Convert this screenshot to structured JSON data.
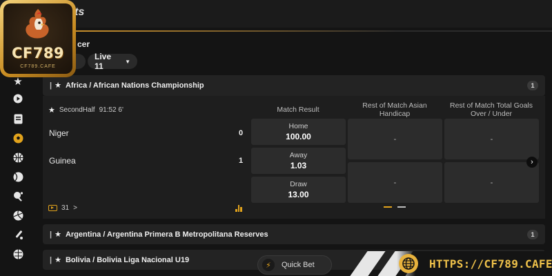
{
  "header": {
    "title_partial": "ts"
  },
  "brand": {
    "logo_text": "CF789",
    "logo_subtext": "CF789.CAFE"
  },
  "section": {
    "title_partial": "cer"
  },
  "filters": {
    "partial_label": ":",
    "live_label": "Live 11"
  },
  "sidebar": {
    "icons": [
      "star-icon",
      "play-icon",
      "betslip-icon",
      "soccer-icon",
      "basketball-icon",
      "tennis-icon",
      "table-tennis-icon",
      "volleyball-icon",
      "cricket-icon",
      "handball-icon"
    ],
    "active": "soccer-icon"
  },
  "leagues": [
    {
      "name": "Africa / African Nations Championship",
      "count": "1"
    },
    {
      "name": "Argentina / Argentina Primera B Metropolitana Reserves",
      "count": "1"
    },
    {
      "name": "Bolivia / Bolivia Liga Nacional U19",
      "count": ""
    }
  ],
  "match": {
    "period": "SecondHalf",
    "clock": "91:52 6'",
    "home_team": "Niger",
    "away_team": "Guinea",
    "home_score": "0",
    "away_score": "1",
    "footer_count": "31",
    "footer_chevron": ">"
  },
  "markets": {
    "match_result": {
      "title": "Match Result",
      "options": [
        {
          "label": "Home",
          "odds": "100.00"
        },
        {
          "label": "Away",
          "odds": "1.03"
        },
        {
          "label": "Draw",
          "odds": "13.00"
        }
      ]
    },
    "asian_handicap": {
      "title": "Rest of Match Asian Handicap",
      "top": "-",
      "bottom": "-"
    },
    "total_goals": {
      "title": "Rest of Match Total Goals Over / Under",
      "top": "-",
      "bottom": "-"
    }
  },
  "quick_bet": {
    "label": "Quick Bet"
  },
  "banner": {
    "url": "HTTPS://CF789.CAFE/"
  },
  "colors": {
    "accent": "#e2a31c",
    "background": "#141414",
    "card": "#232323",
    "cell": "#2c2c2c"
  }
}
